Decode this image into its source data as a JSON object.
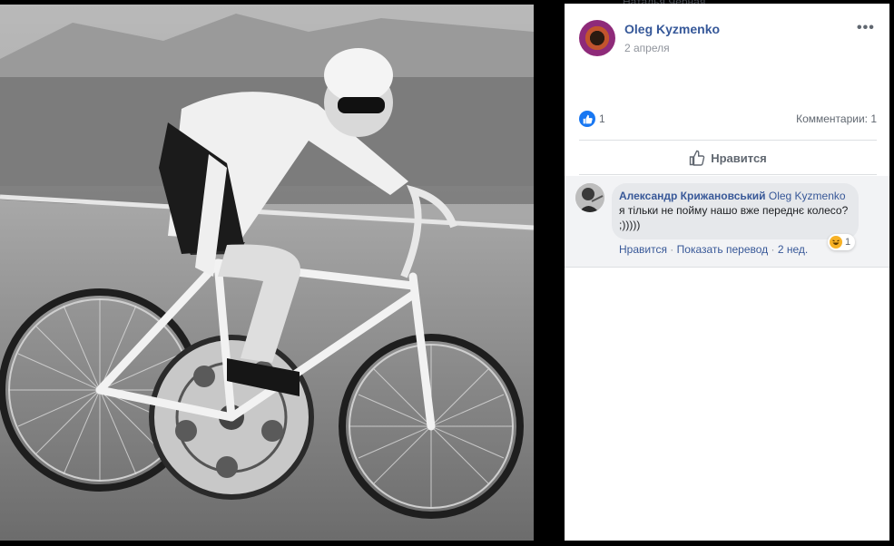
{
  "top_strip": {
    "partial_text": "Наталья Черная"
  },
  "post": {
    "author": "Oleg Kyzmenko",
    "date": "2 апреля",
    "more_icon": "ellipsis-icon",
    "photo_description_colors": {
      "tone": "#7a7a7a"
    }
  },
  "stats": {
    "likes": "1",
    "comments": "Комментарии: 1"
  },
  "actions": {
    "like_label": "Нравится"
  },
  "comment": {
    "author": "Александр Крижановський",
    "mention": "Oleg Kyzmenko",
    "text": " я тільки не пойму нашо вже переднє колесо? ;)))))",
    "reaction_count": "1",
    "like_label": "Нравится",
    "separator1": "·",
    "translate_label": "Показать перевод",
    "separator2": "·",
    "time": "2 нед."
  },
  "colors": {
    "link": "#385898",
    "facebook_blue": "#1877f2",
    "secondary_text": "#90949c"
  }
}
